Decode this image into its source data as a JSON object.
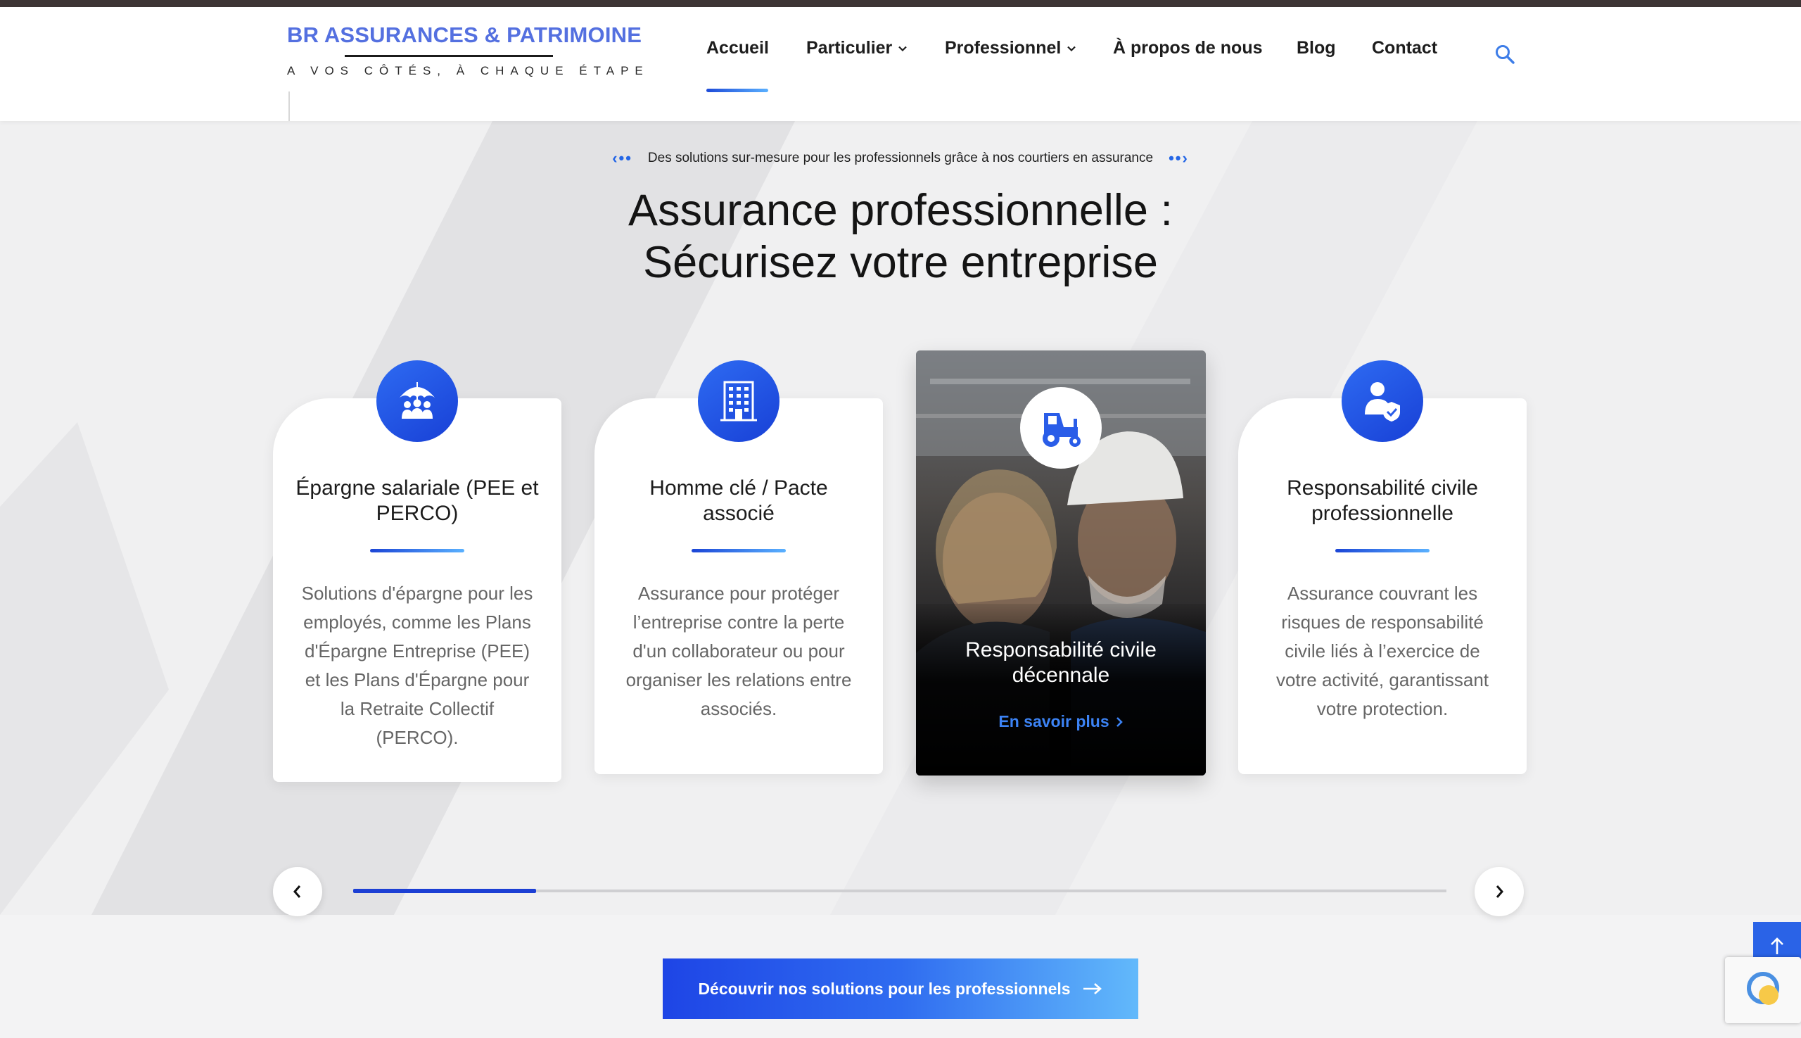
{
  "header": {
    "logo_title": "BR ASSURANCES & PATRIMOINE",
    "logo_tagline": "A VOS CÔTÉS, À CHAQUE ÉTAPE",
    "nav": {
      "accueil": "Accueil",
      "particulier": "Particulier",
      "professionnel": "Professionnel",
      "apropos": "À propos de nous",
      "blog": "Blog",
      "contact": "Contact"
    },
    "active_item": "Accueil"
  },
  "hero": {
    "kicker": "Des solutions sur-mesure pour les professionnels grâce à nos courtiers en assurance",
    "headline_line1": "Assurance professionnelle :",
    "headline_line2": "Sécurisez votre entreprise"
  },
  "cards": [
    {
      "icon": "umbrella-people-icon",
      "title": "Épargne salariale (PEE et PERCO)",
      "description": "Solutions d'épargne pour les employés, comme les Plans d'Épargne Entreprise (PEE) et les Plans d'Épargne pour la Retraite Collectif (PERCO)."
    },
    {
      "icon": "building-icon",
      "title": "Homme clé / Pacte associé",
      "description": "Assurance pour protéger l’entreprise contre la perte d'un collaborateur ou pour organiser les relations entre associés."
    },
    {
      "icon": "tractor-icon",
      "title": "Responsabilité civile décennale",
      "link": "En savoir plus"
    },
    {
      "icon": "user-shield-icon",
      "title": "Responsabilité civile professionnelle",
      "description": "Assurance couvrant les risques de responsabilité civile liés à l’exercice de votre activité, garantissant votre protection."
    }
  ],
  "slider": {
    "progress": 0.167
  },
  "cta": {
    "label": "Découvrir nos solutions pour les professionnels"
  },
  "colors": {
    "brand": "#5470e0",
    "accent": "#2a63e7",
    "text": "#1a1a1a",
    "muted": "#666666"
  }
}
